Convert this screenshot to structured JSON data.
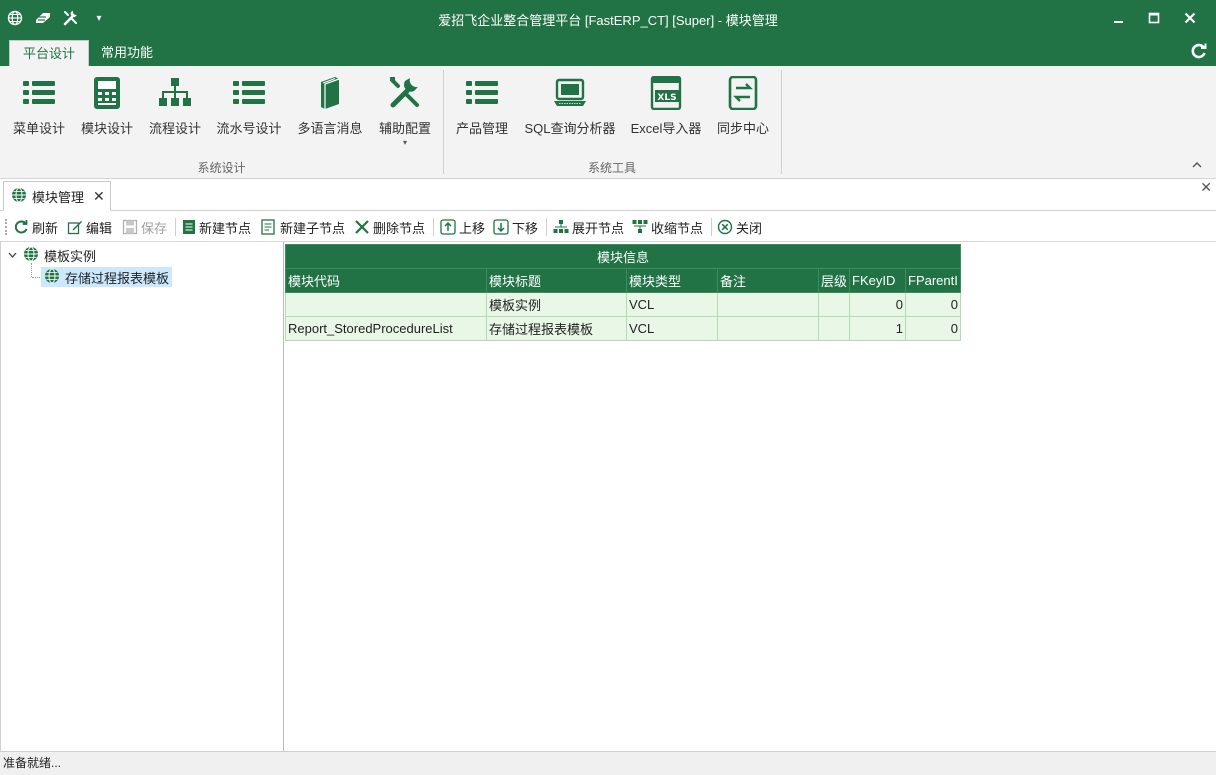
{
  "window": {
    "title": "爱招飞企业整合管理平台 [FastERP_CT] [Super] - 模块管理"
  },
  "ribbon": {
    "tabs": [
      {
        "label": "平台设计",
        "active": true
      },
      {
        "label": "常用功能",
        "active": false
      }
    ],
    "groups": [
      {
        "label": "系统设计",
        "buttons": [
          {
            "label": "菜单设计",
            "icon": "list-icon"
          },
          {
            "label": "模块设计",
            "icon": "calculator-icon"
          },
          {
            "label": "流程设计",
            "icon": "hierarchy-icon"
          },
          {
            "label": "流水号设计",
            "icon": "list-icon"
          },
          {
            "label": "多语言消息",
            "icon": "book-icon"
          },
          {
            "label": "辅助配置",
            "icon": "tools-icon"
          }
        ]
      },
      {
        "label": "系统工具",
        "buttons": [
          {
            "label": "产品管理",
            "icon": "list-icon"
          },
          {
            "label": "SQL查询分析器",
            "icon": "laptop-icon"
          },
          {
            "label": "Excel导入器",
            "icon": "xls-icon"
          },
          {
            "label": "同步中心",
            "icon": "sync-icon"
          }
        ]
      }
    ]
  },
  "doc_tab": {
    "label": "模块管理"
  },
  "toolbar": {
    "refresh": "刷新",
    "edit": "编辑",
    "save": "保存",
    "new_node": "新建节点",
    "new_child": "新建子节点",
    "delete_node": "删除节点",
    "move_up": "上移",
    "move_down": "下移",
    "expand": "展开节点",
    "collapse": "收缩节点",
    "close": "关闭"
  },
  "tree": {
    "root": "模板实例",
    "child": "存储过程报表模板"
  },
  "grid": {
    "band_title": "模块信息",
    "columns": [
      "模块代码",
      "模块标题",
      "模块类型",
      "备注",
      "层级",
      "FKeyID",
      "FParentI"
    ],
    "rows": [
      [
        "",
        "模板实例",
        "VCL",
        "",
        "",
        "0",
        "0"
      ],
      [
        "Report_StoredProcedureList",
        "存储过程报表模板",
        "VCL",
        "",
        "",
        "1",
        "0"
      ]
    ]
  },
  "status": {
    "text": "准备就绪..."
  },
  "colors": {
    "accent": "#217346",
    "grid_row_bg": "#e9f7e7",
    "selection": "#cce8ff"
  }
}
